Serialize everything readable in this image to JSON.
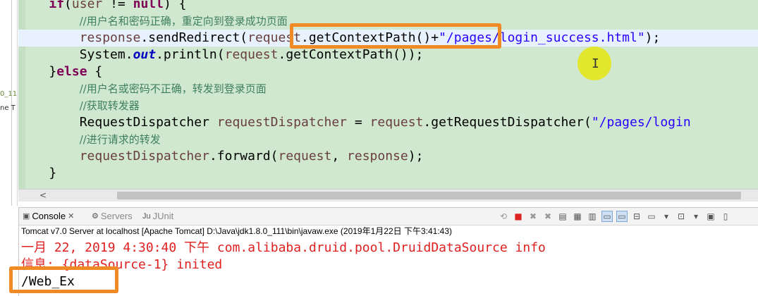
{
  "side_fragments": [
    "0_11",
    "ne T"
  ],
  "editor": {
    "lines": [
      {
        "indent": "    ",
        "parts": [
          {
            "c": "kw",
            "t": "if"
          },
          {
            "c": "plain",
            "t": "("
          },
          {
            "c": "var",
            "t": "user"
          },
          {
            "c": "plain",
            "t": " != "
          },
          {
            "c": "kw",
            "t": "null"
          },
          {
            "c": "plain",
            "t": ") {"
          }
        ]
      },
      {
        "indent": "        ",
        "parts": [
          {
            "c": "cmt",
            "t": "//用户名和密码正确，重定向到登录成功页面"
          }
        ]
      },
      {
        "indent": "        ",
        "current": true,
        "parts": [
          {
            "c": "var",
            "t": "response"
          },
          {
            "c": "plain",
            "t": ".sendRedirect("
          },
          {
            "c": "var",
            "t": "request"
          },
          {
            "c": "plain",
            "t": ".getContextPath()+"
          },
          {
            "c": "str",
            "t": "\"/pages/login_success.html\""
          },
          {
            "c": "plain",
            "t": ");"
          }
        ]
      },
      {
        "indent": "        ",
        "parts": [
          {
            "c": "plain",
            "t": "System."
          },
          {
            "c": "fld",
            "t": "out"
          },
          {
            "c": "plain",
            "t": ".println("
          },
          {
            "c": "var",
            "t": "request"
          },
          {
            "c": "plain",
            "t": ".getContextPath());"
          }
        ]
      },
      {
        "indent": "    ",
        "parts": [
          {
            "c": "plain",
            "t": "}"
          },
          {
            "c": "kw",
            "t": "else"
          },
          {
            "c": "plain",
            "t": " {"
          }
        ]
      },
      {
        "indent": "        ",
        "parts": [
          {
            "c": "cmt",
            "t": "//用户名或密码不正确，转发到登录页面"
          }
        ]
      },
      {
        "indent": "        ",
        "parts": [
          {
            "c": "cmt",
            "t": "//获取转发器"
          }
        ]
      },
      {
        "indent": "        ",
        "parts": [
          {
            "c": "plain",
            "t": "RequestDispatcher "
          },
          {
            "c": "var",
            "t": "requestDispatcher"
          },
          {
            "c": "plain",
            "t": " = "
          },
          {
            "c": "var",
            "t": "request"
          },
          {
            "c": "plain",
            "t": ".getRequestDispatcher("
          },
          {
            "c": "str",
            "t": "\"/pages/login"
          }
        ]
      },
      {
        "indent": "        ",
        "parts": [
          {
            "c": "cmt",
            "t": "//进行请求的转发"
          }
        ]
      },
      {
        "indent": "        ",
        "parts": [
          {
            "c": "var",
            "t": "requestDispatcher"
          },
          {
            "c": "plain",
            "t": ".forward("
          },
          {
            "c": "var",
            "t": "request"
          },
          {
            "c": "plain",
            "t": ", "
          },
          {
            "c": "var",
            "t": "response"
          },
          {
            "c": "plain",
            "t": ");"
          }
        ]
      },
      {
        "indent": "    ",
        "parts": [
          {
            "c": "plain",
            "t": "}"
          }
        ]
      }
    ]
  },
  "console": {
    "tabs": [
      {
        "label": "Console",
        "icon": "console-icon",
        "close": "✕",
        "active": true
      },
      {
        "label": "Servers",
        "icon": "servers-icon",
        "active": false
      },
      {
        "label": "JUnit",
        "icon": "junit-icon",
        "active": false
      }
    ],
    "path": "Tomcat v7.0 Server at localhost [Apache Tomcat] D:\\Java\\jdk1.8.0_111\\bin\\javaw.exe (2019年1月22日 下午3:41:43)",
    "output": [
      {
        "type": "err",
        "text": "一月 22, 2019 4:30:40 下午 com.alibaba.druid.pool.DruidDataSource info"
      },
      {
        "type": "err",
        "text": "信息: {dataSource-1} inited"
      },
      {
        "type": "std",
        "text": "/Web_Ex"
      }
    ]
  },
  "scroll_left_arrow": "<",
  "colors": {
    "editor_bg": "#cfe8cf",
    "highlight_box": "#f08a24",
    "keyword": "#7f0055",
    "string": "#2a00ff",
    "comment": "#3f7f5f",
    "console_error": "#e02020"
  }
}
